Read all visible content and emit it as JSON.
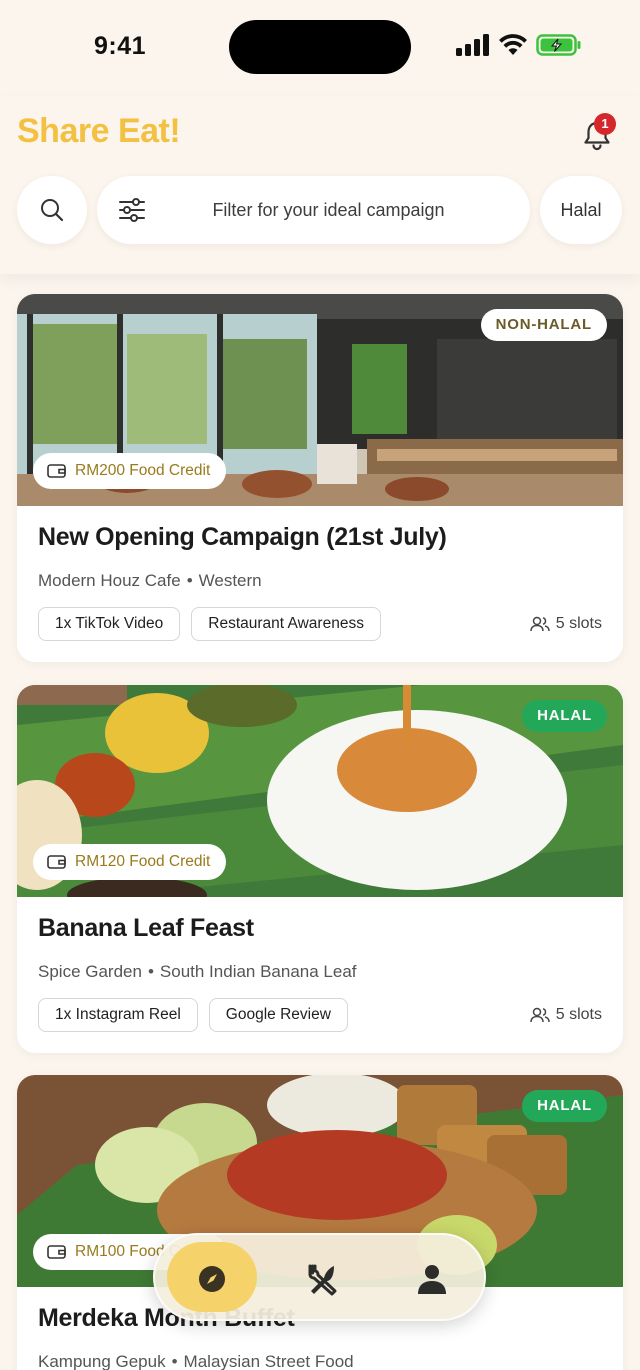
{
  "status_bar": {
    "time": "9:41"
  },
  "header": {
    "app_title": "Share Eat!",
    "notification_count": "1",
    "filter_placeholder": "Filter for your ideal campaign",
    "halal_chip": "Halal"
  },
  "campaigns": [
    {
      "badge": "NON-HALAL",
      "credit": "RM200 Food Credit",
      "title": "New Opening Campaign (21st July)",
      "restaurant": "Modern Houz Cafe",
      "cuisine": "Western",
      "tags": [
        "1x TikTok Video",
        "Restaurant Awareness"
      ],
      "slots": "5 slots"
    },
    {
      "badge": "HALAL",
      "credit": "RM120 Food Credit",
      "title": "Banana Leaf Feast",
      "restaurant": "Spice Garden",
      "cuisine": "South Indian Banana Leaf",
      "tags": [
        "1x Instagram Reel",
        "Google Review"
      ],
      "slots": "5 slots"
    },
    {
      "badge": "HALAL",
      "credit": "RM100 Food Credit",
      "title": "Merdeka Month Buffet",
      "restaurant": "Kampung Gepuk",
      "cuisine": "Malaysian Street Food"
    }
  ],
  "bottom_nav": {
    "items": [
      {
        "icon": "compass-icon",
        "active": true
      },
      {
        "icon": "utensils-icon",
        "active": false
      },
      {
        "icon": "profile-icon",
        "active": false
      }
    ]
  },
  "colors": {
    "brand": "#f3c041",
    "background": "#fbf5ee",
    "halal": "#23a85a",
    "badge_red": "#d4262b",
    "nav_active": "#f5d36a"
  }
}
